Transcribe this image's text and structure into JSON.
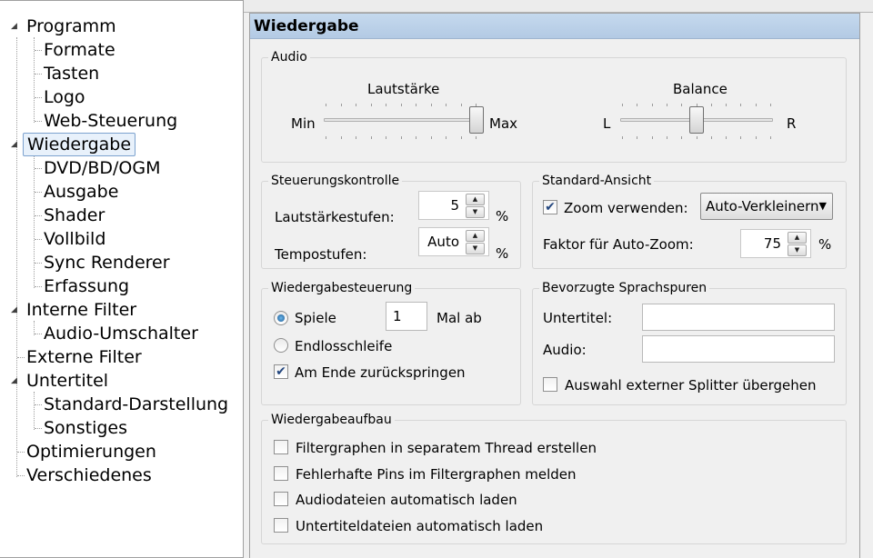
{
  "tree": {
    "items": [
      {
        "label": "Programm",
        "level": 0,
        "expanded": true
      },
      {
        "label": "Formate",
        "level": 1
      },
      {
        "label": "Tasten",
        "level": 1
      },
      {
        "label": "Logo",
        "level": 1
      },
      {
        "label": "Web-Steuerung",
        "level": 1
      },
      {
        "label": "Wiedergabe",
        "level": 0,
        "expanded": true,
        "selected": true
      },
      {
        "label": "DVD/BD/OGM",
        "level": 1
      },
      {
        "label": "Ausgabe",
        "level": 1
      },
      {
        "label": "Shader",
        "level": 1
      },
      {
        "label": "Vollbild",
        "level": 1
      },
      {
        "label": "Sync Renderer",
        "level": 1
      },
      {
        "label": "Erfassung",
        "level": 1
      },
      {
        "label": "Interne Filter",
        "level": 0,
        "expanded": true
      },
      {
        "label": "Audio-Umschalter",
        "level": 1
      },
      {
        "label": "Externe Filter",
        "level": 0
      },
      {
        "label": "Untertitel",
        "level": 0,
        "expanded": true
      },
      {
        "label": "Standard-Darstellung",
        "level": 1
      },
      {
        "label": "Sonstiges",
        "level": 1
      },
      {
        "label": "Optimierungen",
        "level": 0
      },
      {
        "label": "Verschiedenes",
        "level": 0
      }
    ]
  },
  "panel": {
    "title": "Wiedergabe",
    "audio": {
      "legend": "Audio",
      "volume": {
        "label": "Lautstärke",
        "min_label": "Min",
        "max_label": "Max",
        "value_fraction": 1.0
      },
      "balance": {
        "label": "Balance",
        "left_label": "L",
        "right_label": "R",
        "value_fraction": 0.5
      }
    },
    "steuerung": {
      "legend": "Steuerungskontrolle",
      "volume_steps": {
        "label": "Lautstärkestufen:",
        "value": "5",
        "unit": "%"
      },
      "tempo_steps": {
        "label": "Tempostufen:",
        "value": "Auto",
        "unit": "%"
      }
    },
    "ansicht": {
      "legend": "Standard-Ansicht",
      "zoom_label": "Zoom verwenden:",
      "zoom_checked": true,
      "zoom_mode": "Auto-Verkleinern",
      "factor_label": "Faktor für Auto-Zoom:",
      "factor_value": "75",
      "factor_unit": "%"
    },
    "wiedergabe": {
      "legend": "Wiedergabesteuerung",
      "play_label": "Spiele",
      "play_times": "1",
      "play_suffix": "Mal ab",
      "loop_label": "Endlosschleife",
      "rewind_label": "Am Ende zurückspringen",
      "rewind_checked": true,
      "selected_mode": "play"
    },
    "sprachspuren": {
      "legend": "Bevorzugte Sprachspuren",
      "subtitle_label": "Untertitel:",
      "subtitle_value": "",
      "audio_label": "Audio:",
      "audio_value": "",
      "skip_splitter_label": "Auswahl externer Splitter übergehen",
      "skip_splitter_checked": false
    },
    "aufbau": {
      "legend": "Wiedergabeaufbau",
      "options": [
        {
          "label": "Filtergraphen in separatem Thread erstellen",
          "checked": false
        },
        {
          "label": "Fehlerhafte Pins im Filtergraphen melden",
          "checked": false
        },
        {
          "label": "Audiodateien automatisch laden",
          "checked": false
        },
        {
          "label": "Untertiteldateien automatisch laden",
          "checked": false
        }
      ]
    }
  },
  "colors": {
    "title_bar": "#c5d9ee",
    "selection_border": "#7da2ce",
    "check_mark": "#24477f"
  }
}
